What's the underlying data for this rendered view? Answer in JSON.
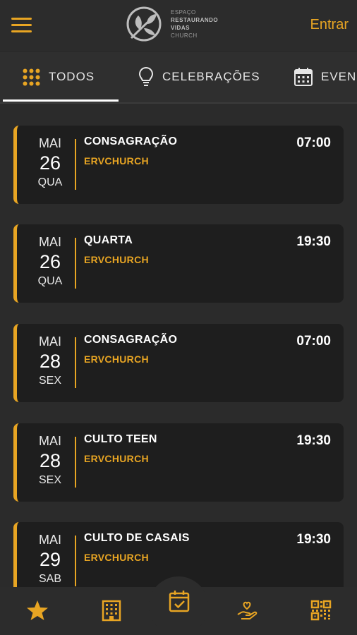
{
  "header": {
    "logo_lines": [
      "ESPAÇO",
      "RESTAURANDO",
      "VIDAS",
      "CHURCH"
    ],
    "login_label": "Entrar",
    "menu_icon": "hamburger-menu-icon"
  },
  "tabs": [
    {
      "label": "TODOS",
      "icon": "grid-icon",
      "active": true
    },
    {
      "label": "CELEBRAÇÕES",
      "icon": "lightbulb-icon",
      "active": false
    },
    {
      "label": "EVEN",
      "icon": "calendar-icon",
      "active": false
    }
  ],
  "events": [
    {
      "month": "MAI",
      "day": "26",
      "weekday": "QUA",
      "title": "CONSAGRAÇÃO",
      "org": "ERVCHURCH",
      "time": "07:00"
    },
    {
      "month": "MAI",
      "day": "26",
      "weekday": "QUA",
      "title": "QUARTA",
      "org": "ERVCHURCH",
      "time": "19:30"
    },
    {
      "month": "MAI",
      "day": "28",
      "weekday": "SEX",
      "title": "CONSAGRAÇÃO",
      "org": "ERVCHURCH",
      "time": "07:00"
    },
    {
      "month": "MAI",
      "day": "28",
      "weekday": "SEX",
      "title": "CULTO TEEN",
      "org": "ERVCHURCH",
      "time": "19:30"
    },
    {
      "month": "MAI",
      "day": "29",
      "weekday": "SAB",
      "title": "CULTO DE CASAIS",
      "org": "ERVCHURCH",
      "time": "19:30"
    }
  ],
  "bottom_nav": [
    {
      "icon": "star-icon"
    },
    {
      "icon": "building-icon"
    },
    {
      "icon": "calendar-check-icon"
    },
    {
      "icon": "hand-heart-icon"
    },
    {
      "icon": "qr-code-icon"
    }
  ],
  "colors": {
    "accent": "#e8a523",
    "background": "#2b2b2b",
    "card": "#1e1e1e"
  }
}
